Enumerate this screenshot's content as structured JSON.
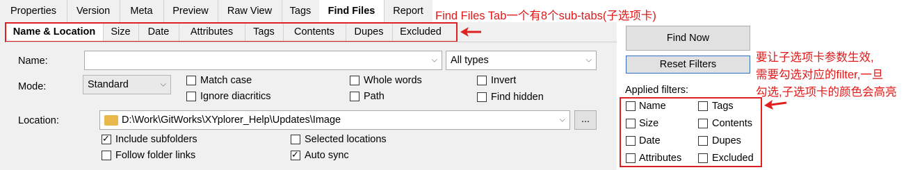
{
  "main_tabs": [
    "Properties",
    "Version",
    "Meta",
    "Preview",
    "Raw View",
    "Tags",
    "Find Files",
    "Report"
  ],
  "active_main_tab": "Find Files",
  "sub_tabs": [
    "Name & Location",
    "Size",
    "Date",
    "Attributes",
    "Tags",
    "Contents",
    "Dupes",
    "Excluded"
  ],
  "active_sub_tab": "Name & Location",
  "form": {
    "name_label": "Name:",
    "name_value": "",
    "type_value": "All types",
    "mode_label": "Mode:",
    "mode_value": "Standard",
    "match_case": "Match case",
    "ignore_diacritics": "Ignore diacritics",
    "whole_words": "Whole words",
    "path": "Path",
    "invert": "Invert",
    "find_hidden": "Find hidden",
    "location_label": "Location:",
    "location_value": "D:\\Work\\GitWorks\\XYplorer_Help\\Updates\\Image",
    "browse_label": "...",
    "include_subfolders": "Include subfolders",
    "follow_folder_links": "Follow folder links",
    "selected_locations": "Selected locations",
    "auto_sync": "Auto sync"
  },
  "buttons": {
    "find_now": "Find Now",
    "reset_filters": "Reset Filters"
  },
  "applied_filters": {
    "title": "Applied filters:",
    "left": [
      "Name",
      "Size",
      "Date",
      "Attributes"
    ],
    "right": [
      "Tags",
      "Contents",
      "Dupes",
      "Excluded"
    ]
  },
  "annotations": {
    "tab_note": "Find Files Tab一个有8个sub-tabs(子选项卡)",
    "filter_note_1": "要让子选项卡参数生效,",
    "filter_note_2": "需要勾选对应的filter,一旦",
    "filter_note_3": "勾选,子选项卡的颜色会高亮"
  },
  "colors": {
    "annotation_red": "#e02020",
    "tab_bg": "#f0f0f0",
    "active_tab_bg": "#ffffff"
  }
}
